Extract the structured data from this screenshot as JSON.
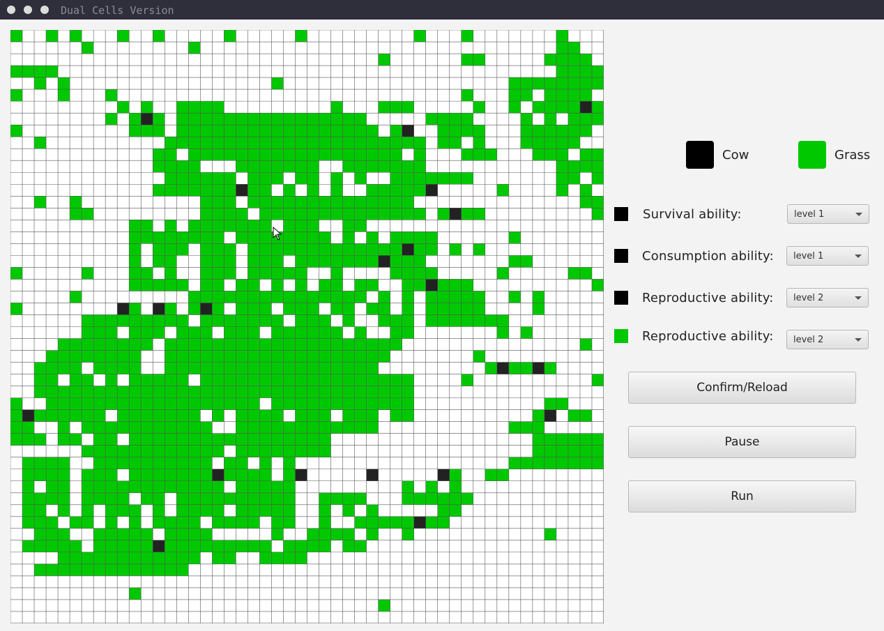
{
  "window": {
    "title": "Dual Cells Version"
  },
  "colors": {
    "cow": "#222222",
    "grass": "#00c800",
    "empty": "#ffffff",
    "gridline": "#555555"
  },
  "legend": {
    "cow_label": "Cow",
    "grass_label": "Grass"
  },
  "settings": [
    {
      "label": "Survival ability:",
      "swatch": "cow",
      "value": "level 1"
    },
    {
      "label": "Consumption ability:",
      "swatch": "cow",
      "value": "level 1"
    },
    {
      "label": "Reproductive ability:",
      "swatch": "cow",
      "value": "level 2"
    },
    {
      "label": "Reproductive ability:",
      "swatch": "grass",
      "value": "level 2"
    }
  ],
  "buttons": {
    "confirm": "Confirm/Reload",
    "pause": "Pause",
    "run": "Run"
  },
  "board": {
    "cols": 50,
    "rows": 50,
    "cells": [
      "G..G.G...G..G.....G.....G.........G...G.......G...",
      "......G........G..............................GG..",
      "...............................G......GG.....GGGG.",
      "GGGG..........................................GGGG",
      "..G.G.................G...................GGGGGGGG",
      "G...G...G.............................G...GG.GGGG.",
      ".........G.G..GGGG.........G...GGG.....G..G.GGGGCG",
      "........G.GCG.GGGGGGGGGGGGGGGG.....GGGG....G.G.GGG",
      "G.........GGG.GGGGGGGGGGGGGGGGG.GC..GGGG...GGGGGG.G",
      "..G..........GGGGGGGGGGGGGGGGGGGGGG.GG.G...GGGGG..G",
      "............GG.GGGGGGGGGGGGGGGGGG.G...GGG...GGG.GGGG",
      "............GGGG...GGGGGGG..GGGGGGG...........GGGGGG",
      ".............GGGGGG.GGG.GG.G.G..GGGGGGG.......GG.G.GG",
      "............GGGGGGGCGG.G.G.G..GGGGGC.....G....G.G.",
      "..G..G..........GGG.GGGGGGGGGGGGGG..............GGG.",
      ".....GG.........GGGG.GGGGGGGGGGGGGG.GCGG.........G.C.",
      "..........GG.G.GGGGGGG.GGG..GG..........................",
      "..........GGGGGGGG.GGGGGGGG.G.G.GGGG......G..........",
      "..........G.GGG.GGG.GGGGGGGGGGGGGCGG.G.G..............",
      "..........G.GG..GGG.GGG.GGGGGGGCGGG.......GG..........",
      "G.....G...GG.G..GGG.GGGGG..G....GGGG.....G.....GG....",
      "..........GGGGG.GG.GG.G.G.GG.GG..GGCGGG..........GGG..",
      ".....G.........GGGGGGGGGGGGGGG.G.G.GGGGG..G.G........G",
      "G........CG.CG.GCG.GGG.GGG.GG.GG.G.GGGGG....G.........",
      "......GGGGGGGGG.GGGGGGG.GGG.G..GGG.GGGGGGG..........",
      "......GGG.GGG.GGG.GGG.GGGGGG.G..GG.......G.G......G..",
      "....GGGGGGGG.GGGGGGGGGGGGGGGGGGGG...............G..",
      "...GGGGGGGG..GGGGGGGGGGGGGGGGGGG.......G...........GGG",
      "..GGGG.GGGG..GGGGGGGGGGGGGGGGGG.........GCGGCG......G.G",
      "..GG.GG.G.GGGGG.GGGGGGGGGGGGGGGGGG....G..........GG.G..",
      "..GGGGGGGGGGGGGGGGGGGGGGGGGGGGGGGG...................",
      "G..GGGGGGGGGGGGGGGGGG.GGGGGGGGGGGG...........GG........",
      "GCGGGGGG.GGGGGGG.G.GGGG.GGG.GGG.GG..........GC.GG..G.G",
      "GG..G.GGGGGGGGGGG..GGGGGGGGGGGG...........GGG..........",
      "GGG.GG.GG.GGGGGGGGGGGGGGGGG.................GGGGGG...G.G",
      "......GGGGGGGGGGGG.GGGGGGGG.................GGGGGGG.G..",
      ".GGGG..GGGGGGGGGG.GG.G.G..................GGGGGGGGGGG.",
      ".GGGG.GGG.GGGGGGGCGGGG.GC.....C.....CG..GG..............",
      ".G.GG.GGGGGGGGGGGG.GGGGG.........G.G.G................",
      ".GGGG.GGGG.GG.GGGGGGGGGG..GGGG...GGGGGG.............",
      ".GG.G.G.GGG.G.GGGG.GGGGG..G.G.G.....GG................",
      ".GGG.GG.G.G.GGGG.GGGG.GG..G..GGGGGCGG..................G.",
      "..GGG..GGGGG.GGGG.....G..GGGG.G..G...........G..........",
      ".GGGGG.GGGGGCGGGGGGGGG.GGGG.GG........................GG",
      "....GGGGGGGGGGGG.GG..GGGG..............................G",
      "..GGGGGGGGGGGGG...............................................G",
      "...................................................",
      "..........G..........................................",
      "...............................G...................",
      "...................................................."
    ]
  }
}
